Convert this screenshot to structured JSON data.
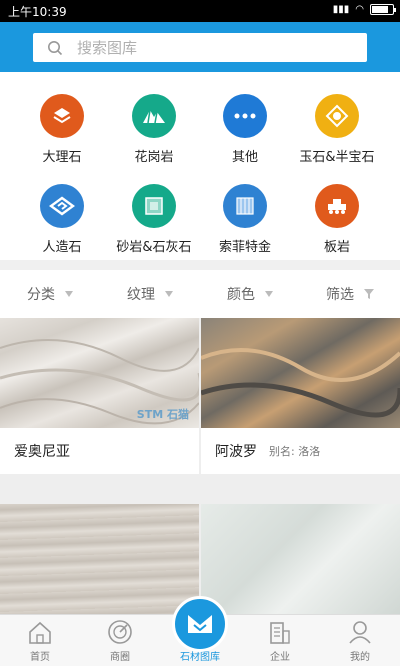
{
  "status": {
    "time": "上午10:39"
  },
  "search": {
    "placeholder": "搜索图库"
  },
  "categories": [
    {
      "label": "大理石",
      "icon": "layers-icon",
      "color": "#e05a1c"
    },
    {
      "label": "花岗岩",
      "icon": "mountain-icon",
      "color": "#15a98a"
    },
    {
      "label": "其他",
      "icon": "more-icon",
      "color": "#1f7ad6"
    },
    {
      "label": "玉石&半宝石",
      "icon": "gem-icon",
      "color": "#f0b012"
    },
    {
      "label": "人造石",
      "icon": "diamond-g-icon",
      "color": "#2f82d2"
    },
    {
      "label": "砂岩&石灰石",
      "icon": "tile-icon",
      "color": "#15a98a"
    },
    {
      "label": "索菲特金",
      "icon": "panel-icon",
      "color": "#2f82d2"
    },
    {
      "label": "板岩",
      "icon": "machine-icon",
      "color": "#e05a1c"
    }
  ],
  "filters": [
    {
      "label": "分类"
    },
    {
      "label": "纹理"
    },
    {
      "label": "颜色"
    },
    {
      "label": "筛选"
    }
  ],
  "products": [
    {
      "name": "爱奥尼亚",
      "alias": "",
      "watermark": "STM 石猫"
    },
    {
      "name": "阿波罗",
      "alias": "别名: 洛洛",
      "watermark": ""
    },
    {
      "name": "",
      "alias": "",
      "watermark": ""
    },
    {
      "name": "",
      "alias": "",
      "watermark": ""
    }
  ],
  "nav": [
    {
      "label": "首页",
      "icon": "home-icon"
    },
    {
      "label": "商圈",
      "icon": "radar-icon"
    },
    {
      "label": "石材图库",
      "icon": "gallery-icon"
    },
    {
      "label": "企业",
      "icon": "company-icon"
    },
    {
      "label": "我的",
      "icon": "user-icon"
    }
  ],
  "colors": {
    "accent": "#1b98de"
  }
}
